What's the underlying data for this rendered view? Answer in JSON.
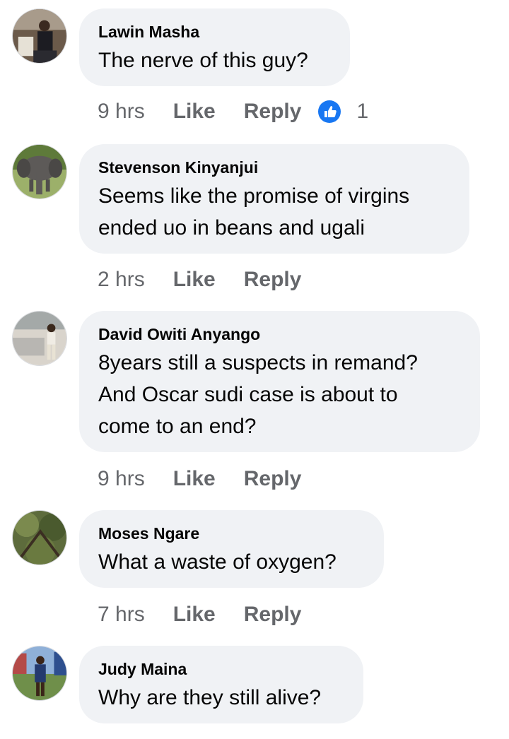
{
  "comments": [
    {
      "author": "Lawin Masha",
      "lines": [
        "The nerve of this guy?"
      ],
      "time": "9 hrs",
      "like_label": "Like",
      "reply_label": "Reply",
      "reaction_icon": "like-thumb-icon",
      "reaction_count": "1"
    },
    {
      "author": "Stevenson Kinyanjui",
      "lines": [
        "Seems like the promise of virgins",
        "ended uo in beans and ugali"
      ],
      "time": "2 hrs",
      "like_label": "Like",
      "reply_label": "Reply"
    },
    {
      "author": "David Owiti Anyango",
      "lines": [
        "8years still a suspects in remand?",
        "And Oscar sudi case is about to",
        "come to an end?"
      ],
      "time": "9 hrs",
      "like_label": "Like",
      "reply_label": "Reply"
    },
    {
      "author": "Moses Ngare",
      "lines": [
        "What a waste of oxygen?"
      ],
      "time": "7 hrs",
      "like_label": "Like",
      "reply_label": "Reply"
    },
    {
      "author": "Judy Maina",
      "lines": [
        "Why are they still alive?"
      ]
    }
  ],
  "colors": {
    "bubble": "#f0f2f5",
    "meta_text": "#65676b",
    "like_blue": "#1877f2"
  }
}
